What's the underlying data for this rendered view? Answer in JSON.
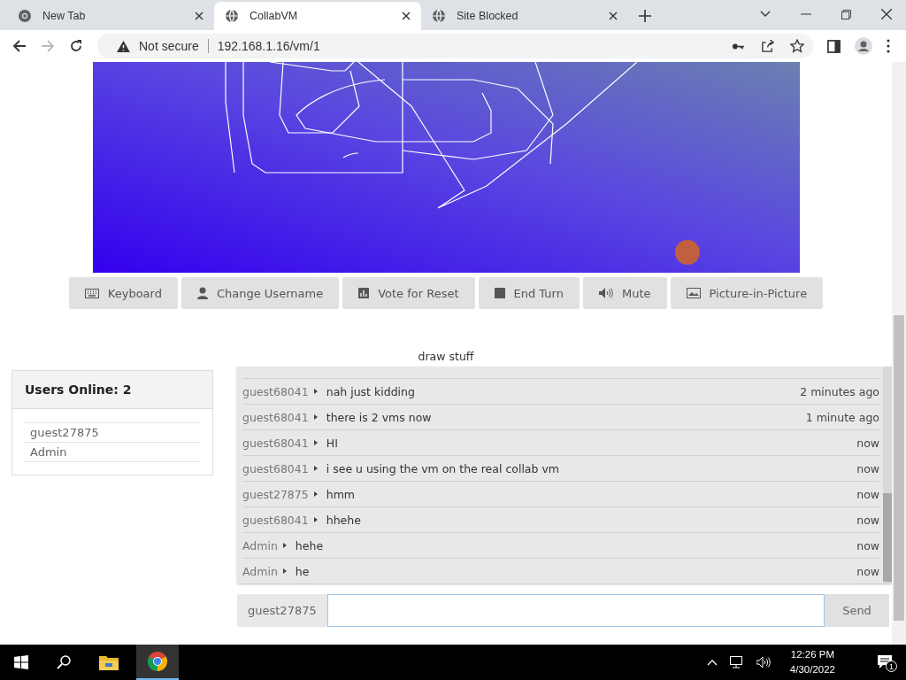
{
  "browser": {
    "tabs": [
      {
        "title": "New Tab",
        "selected": false
      },
      {
        "title": "CollabVM",
        "selected": true
      },
      {
        "title": "Site Blocked",
        "selected": false
      }
    ],
    "security": "Not secure",
    "url": "192.168.1.16/vm/1"
  },
  "toolbar": [
    "Keyboard",
    "Change Username",
    "Vote for Reset",
    "End Turn",
    "Mute",
    "Picture-in-Picture"
  ],
  "vm_title": "draw stuff",
  "users": {
    "heading": "Users Online: 2",
    "list": [
      "guest27875",
      "Admin"
    ]
  },
  "chat": [
    {
      "user": "guest68041",
      "text": "nah just kidding",
      "time": "2 minutes ago"
    },
    {
      "user": "guest68041",
      "text": "there is 2 vms now",
      "time": "1 minute ago"
    },
    {
      "user": "guest68041",
      "text": "HI",
      "time": "now"
    },
    {
      "user": "guest68041",
      "text": "i see u using the vm on the real collab vm",
      "time": "now"
    },
    {
      "user": "guest27875",
      "text": "hmm",
      "time": "now"
    },
    {
      "user": "guest68041",
      "text": "hhehe",
      "time": "now"
    },
    {
      "user": "Admin",
      "text": "hehe",
      "time": "now"
    },
    {
      "user": "Admin",
      "text": "he",
      "time": "now"
    }
  ],
  "chat_input": {
    "username": "guest27875",
    "button": "Send"
  },
  "taskbar": {
    "time": "12:26 PM",
    "date": "4/30/2022",
    "notifications": "1"
  }
}
